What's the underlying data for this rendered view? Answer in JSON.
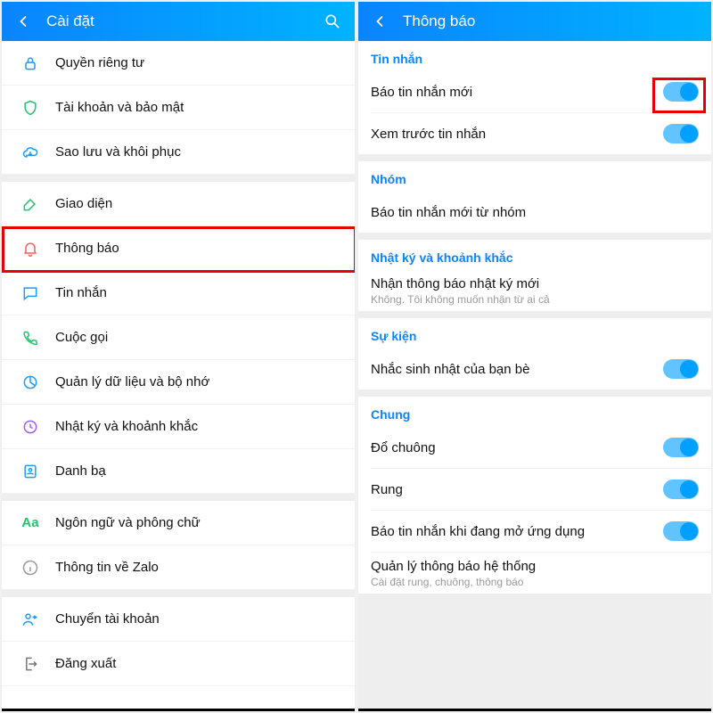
{
  "left": {
    "title": "Cài đặt",
    "items": [
      {
        "icon": "lock-icon",
        "label": "Quyền riêng tư"
      },
      {
        "icon": "shield-icon",
        "label": "Tài khoản và bảo mật"
      },
      {
        "icon": "cloud-icon",
        "label": "Sao lưu và khôi phục"
      },
      {
        "icon": "brush-icon",
        "label": "Giao diện"
      },
      {
        "icon": "bell-icon",
        "label": "Thông báo"
      },
      {
        "icon": "chat-icon",
        "label": "Tin nhắn"
      },
      {
        "icon": "phone-icon",
        "label": "Cuộc gọi"
      },
      {
        "icon": "pie-icon",
        "label": "Quản lý dữ liệu và bộ nhớ"
      },
      {
        "icon": "clock-icon",
        "label": "Nhật ký và khoảnh khắc"
      },
      {
        "icon": "contacts-icon",
        "label": "Danh bạ"
      },
      {
        "icon": "aa-icon",
        "label": "Ngôn ngữ và phông chữ"
      },
      {
        "icon": "info-icon",
        "label": "Thông tin về Zalo"
      },
      {
        "icon": "switch-icon",
        "label": "Chuyển tài khoản"
      },
      {
        "icon": "logout-icon",
        "label": "Đăng xuất"
      }
    ],
    "gaps_after": [
      2,
      9,
      11
    ]
  },
  "right": {
    "title": "Thông báo",
    "sections": {
      "msg": {
        "header": "Tin nhắn",
        "new_msg": "Báo tin nhắn mới",
        "preview": "Xem trước tin nhắn"
      },
      "group": {
        "header": "Nhóm",
        "new_group_msg": "Báo tin nhắn mới từ nhóm"
      },
      "diary": {
        "header": "Nhật ký và khoảnh khắc",
        "label": "Nhận thông báo nhật ký mới",
        "sub": "Không. Tôi không muốn nhận từ ai cả"
      },
      "event": {
        "header": "Sự kiện",
        "birthday": "Nhắc sinh nhật của bạn bè"
      },
      "general": {
        "header": "Chung",
        "ring": "Đổ chuông",
        "vibrate": "Rung",
        "while_open": "Báo tin nhắn khi đang mở ứng dụng",
        "sys": "Quản lý thông báo hệ thống",
        "sys_sub": "Cài đặt rung, chuông, thông báo"
      }
    }
  }
}
